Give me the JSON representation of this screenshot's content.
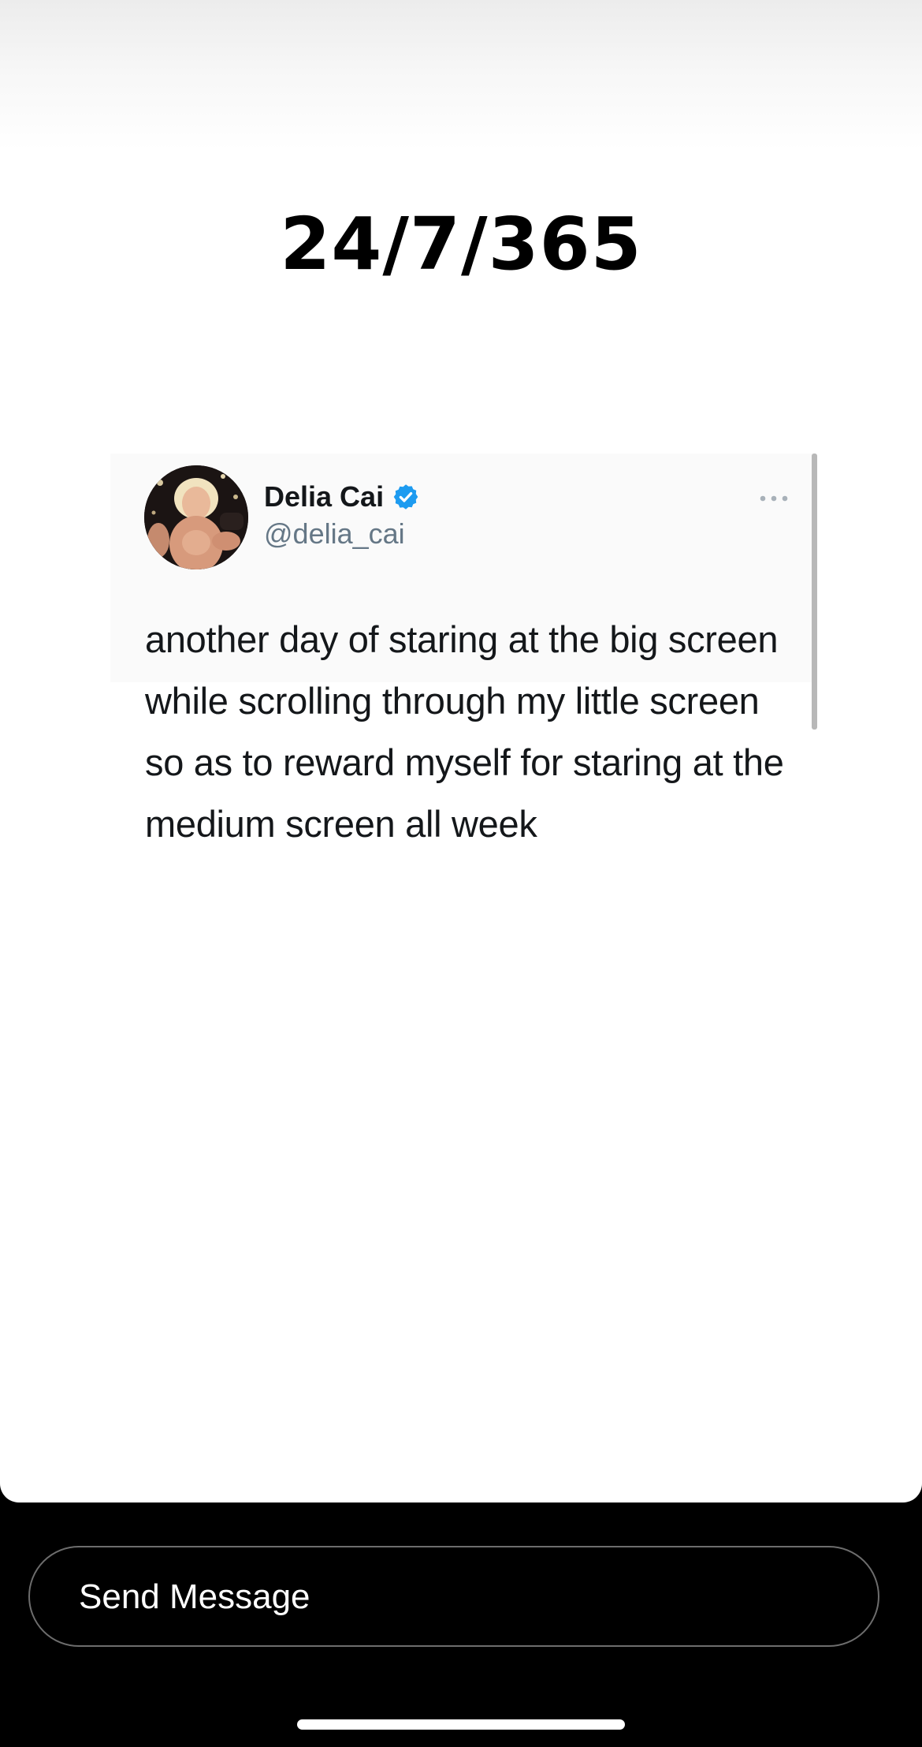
{
  "story": {
    "title": "24/7/365"
  },
  "tweet": {
    "author_name": "Delia Cai",
    "handle": "@delia_cai",
    "verified": true,
    "verified_color": "#1d9bf0",
    "more_icon": "ellipsis-icon",
    "text": "another day of staring at the big screen while scrolling through my little screen so as to reward myself for staring at the medium screen all week"
  },
  "reply_bar": {
    "placeholder": "Send Message"
  },
  "colors": {
    "background": "#000000",
    "card": "#ffffff",
    "handle_gray": "#657786"
  }
}
